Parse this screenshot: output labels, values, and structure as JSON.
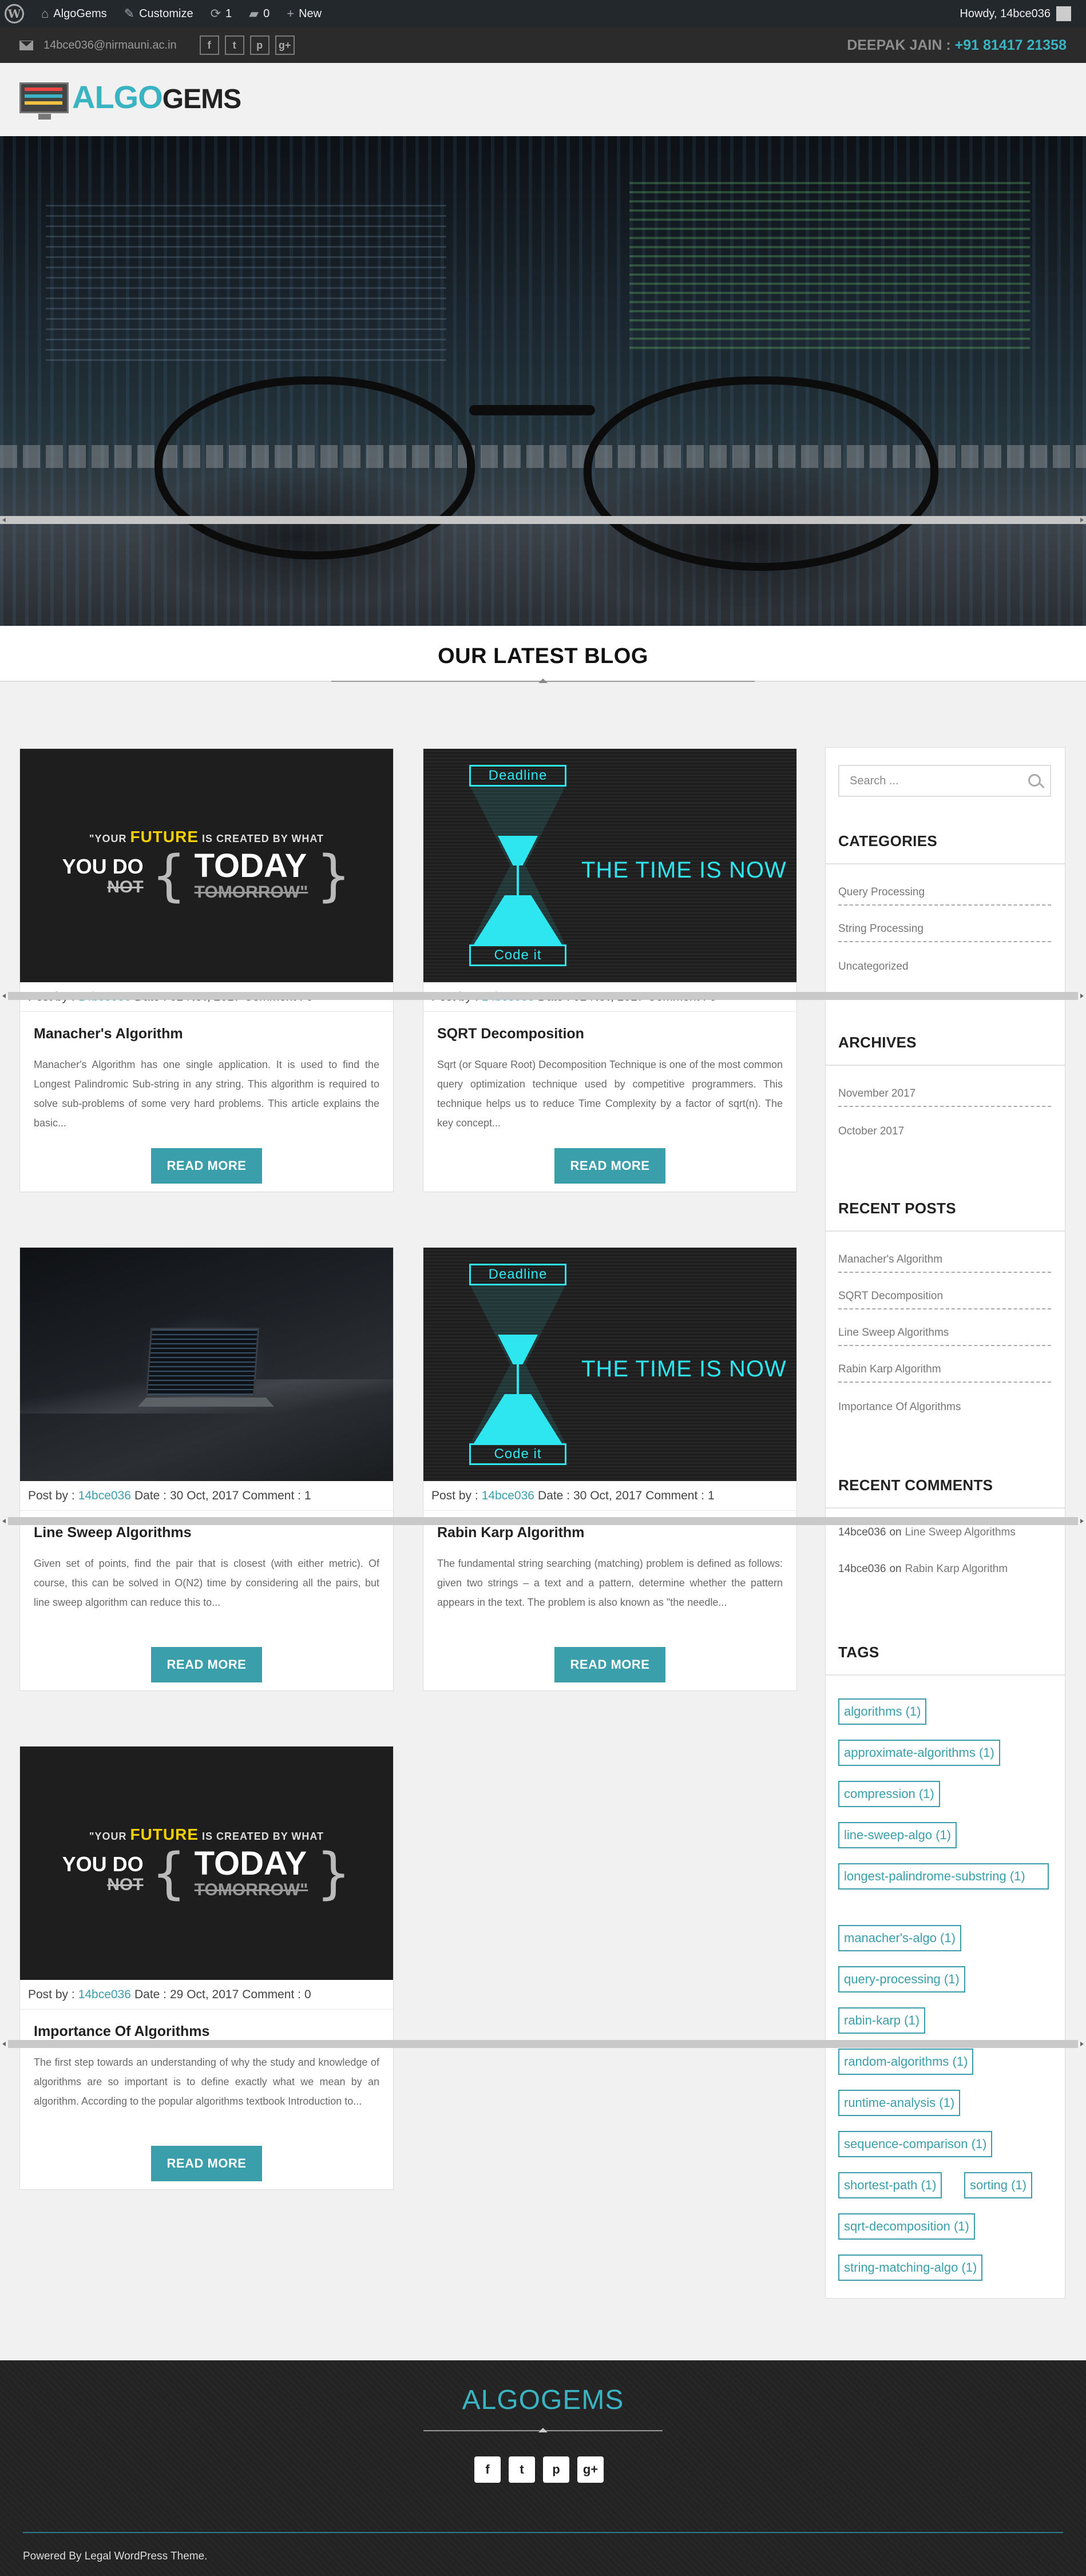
{
  "admin_bar": {
    "site": "AlgoGems",
    "customize": "Customize",
    "updates": "1",
    "comments": "0",
    "new": "New",
    "howdy": "Howdy, 14bce036"
  },
  "contact": {
    "email": "14bce036@nirmauni.ac.in",
    "name": "DEEPAK JAIN :",
    "phone": "+91 81417 21358",
    "social": [
      "f",
      "t",
      "p",
      "g+"
    ]
  },
  "logo": {
    "part1": "ALGO",
    "part2": "GEMS"
  },
  "section": {
    "title": "OUR LATEST BLOG"
  },
  "post_labels": {
    "post_by": "Post by :",
    "date": "Date :",
    "comment": "Comment :",
    "read_more": "READ MORE"
  },
  "quote_image": {
    "line1a": "\"YOUR",
    "line1b": "FUTURE",
    "line1c": "IS CREATED BY WHAT",
    "you_do": "YOU DO",
    "not": "NOT",
    "today": "TODAY",
    "tomorrow": "TOMORROW\""
  },
  "hourglass_image": {
    "top": "Deadline",
    "bottom": "Code it",
    "text": "THE TIME IS NOW"
  },
  "posts": [
    {
      "author": "14bce036",
      "date": "02 Nov, 2017",
      "comments": "0",
      "title": "Manacher's Algorithm",
      "excerpt": "Manacher's Algorithm has one single application. It is used to find the Longest Palindromic Sub-string in any string. This algorithm is required to solve sub-problems of some very hard problems. This article explains the basic..."
    },
    {
      "author": "14bce036",
      "date": "02 Nov, 2017",
      "comments": "0",
      "title": "SQRT Decomposition",
      "excerpt": "Sqrt (or Square Root) Decomposition Technique is one of the most common query optimization technique used by competitive programmers. This technique helps us to reduce Time Complexity by a factor of sqrt(n). The key concept..."
    },
    {
      "author": "14bce036",
      "date": "30 Oct, 2017",
      "comments": "1",
      "title": "Line Sweep Algorithms",
      "excerpt": "Given set of points, find the pair that is closest (with either metric). Of course, this can be solved in O(N2) time by considering all the pairs, but line sweep algorithm can reduce this to..."
    },
    {
      "author": "14bce036",
      "date": "30 Oct, 2017",
      "comments": "1",
      "title": "Rabin Karp Algorithm",
      "excerpt": "The fundamental string searching (matching) problem is defined as follows: given two strings – a text and a pattern, determine whether the pattern appears in the text. The problem is also known as \"the needle..."
    },
    {
      "author": "14bce036",
      "date": "29 Oct, 2017",
      "comments": "0",
      "title": "Importance Of Algorithms",
      "excerpt": "The first step towards an understanding of why the study and knowledge of algorithms are so important is to define exactly what we mean by an algorithm. According to the popular algorithms textbook Introduction to..."
    }
  ],
  "sidebar": {
    "search_placeholder": "Search ...",
    "categories_title": "CATEGORIES",
    "categories": [
      "Query Processing",
      "String Processing",
      "Uncategorized"
    ],
    "archives_title": "ARCHIVES",
    "archives": [
      "November 2017",
      "October 2017"
    ],
    "recent_posts_title": "RECENT POSTS",
    "recent_posts": [
      "Manacher's Algorithm",
      "SQRT Decomposition",
      "Line Sweep Algorithms",
      "Rabin Karp Algorithm",
      "Importance Of Algorithms"
    ],
    "recent_comments_title": "RECENT COMMENTS",
    "recent_comments": [
      {
        "author": "14bce036",
        "on": "on",
        "post": "Line Sweep Algorithms"
      },
      {
        "author": "14bce036",
        "on": "on",
        "post": "Rabin Karp Algorithm"
      }
    ],
    "tags_title": "TAGS",
    "tags": [
      "algorithms (1)",
      "approximate-algorithms (1)",
      "compression (1)",
      "line-sweep-algo (1)",
      "longest-palindrome-substring (1)",
      "manacher's-algo (1)",
      "query-processing (1)",
      "rabin-karp (1)",
      "random-algorithms (1)",
      "runtime-analysis (1)",
      "sequence-comparison (1)",
      "shortest-path (1)",
      "sorting (1)",
      "sqrt-decomposition (1)",
      "string-matching-algo (1)"
    ]
  },
  "footer": {
    "title": "ALGOGEMS",
    "credit": "Powered By Legal WordPress Theme.",
    "social": [
      "f",
      "t",
      "p",
      "g+"
    ]
  },
  "colors": {
    "accent": "#3a9fab",
    "brand": "#3ab3c2",
    "admin_bar": "#23282d",
    "footer": "#232323"
  }
}
